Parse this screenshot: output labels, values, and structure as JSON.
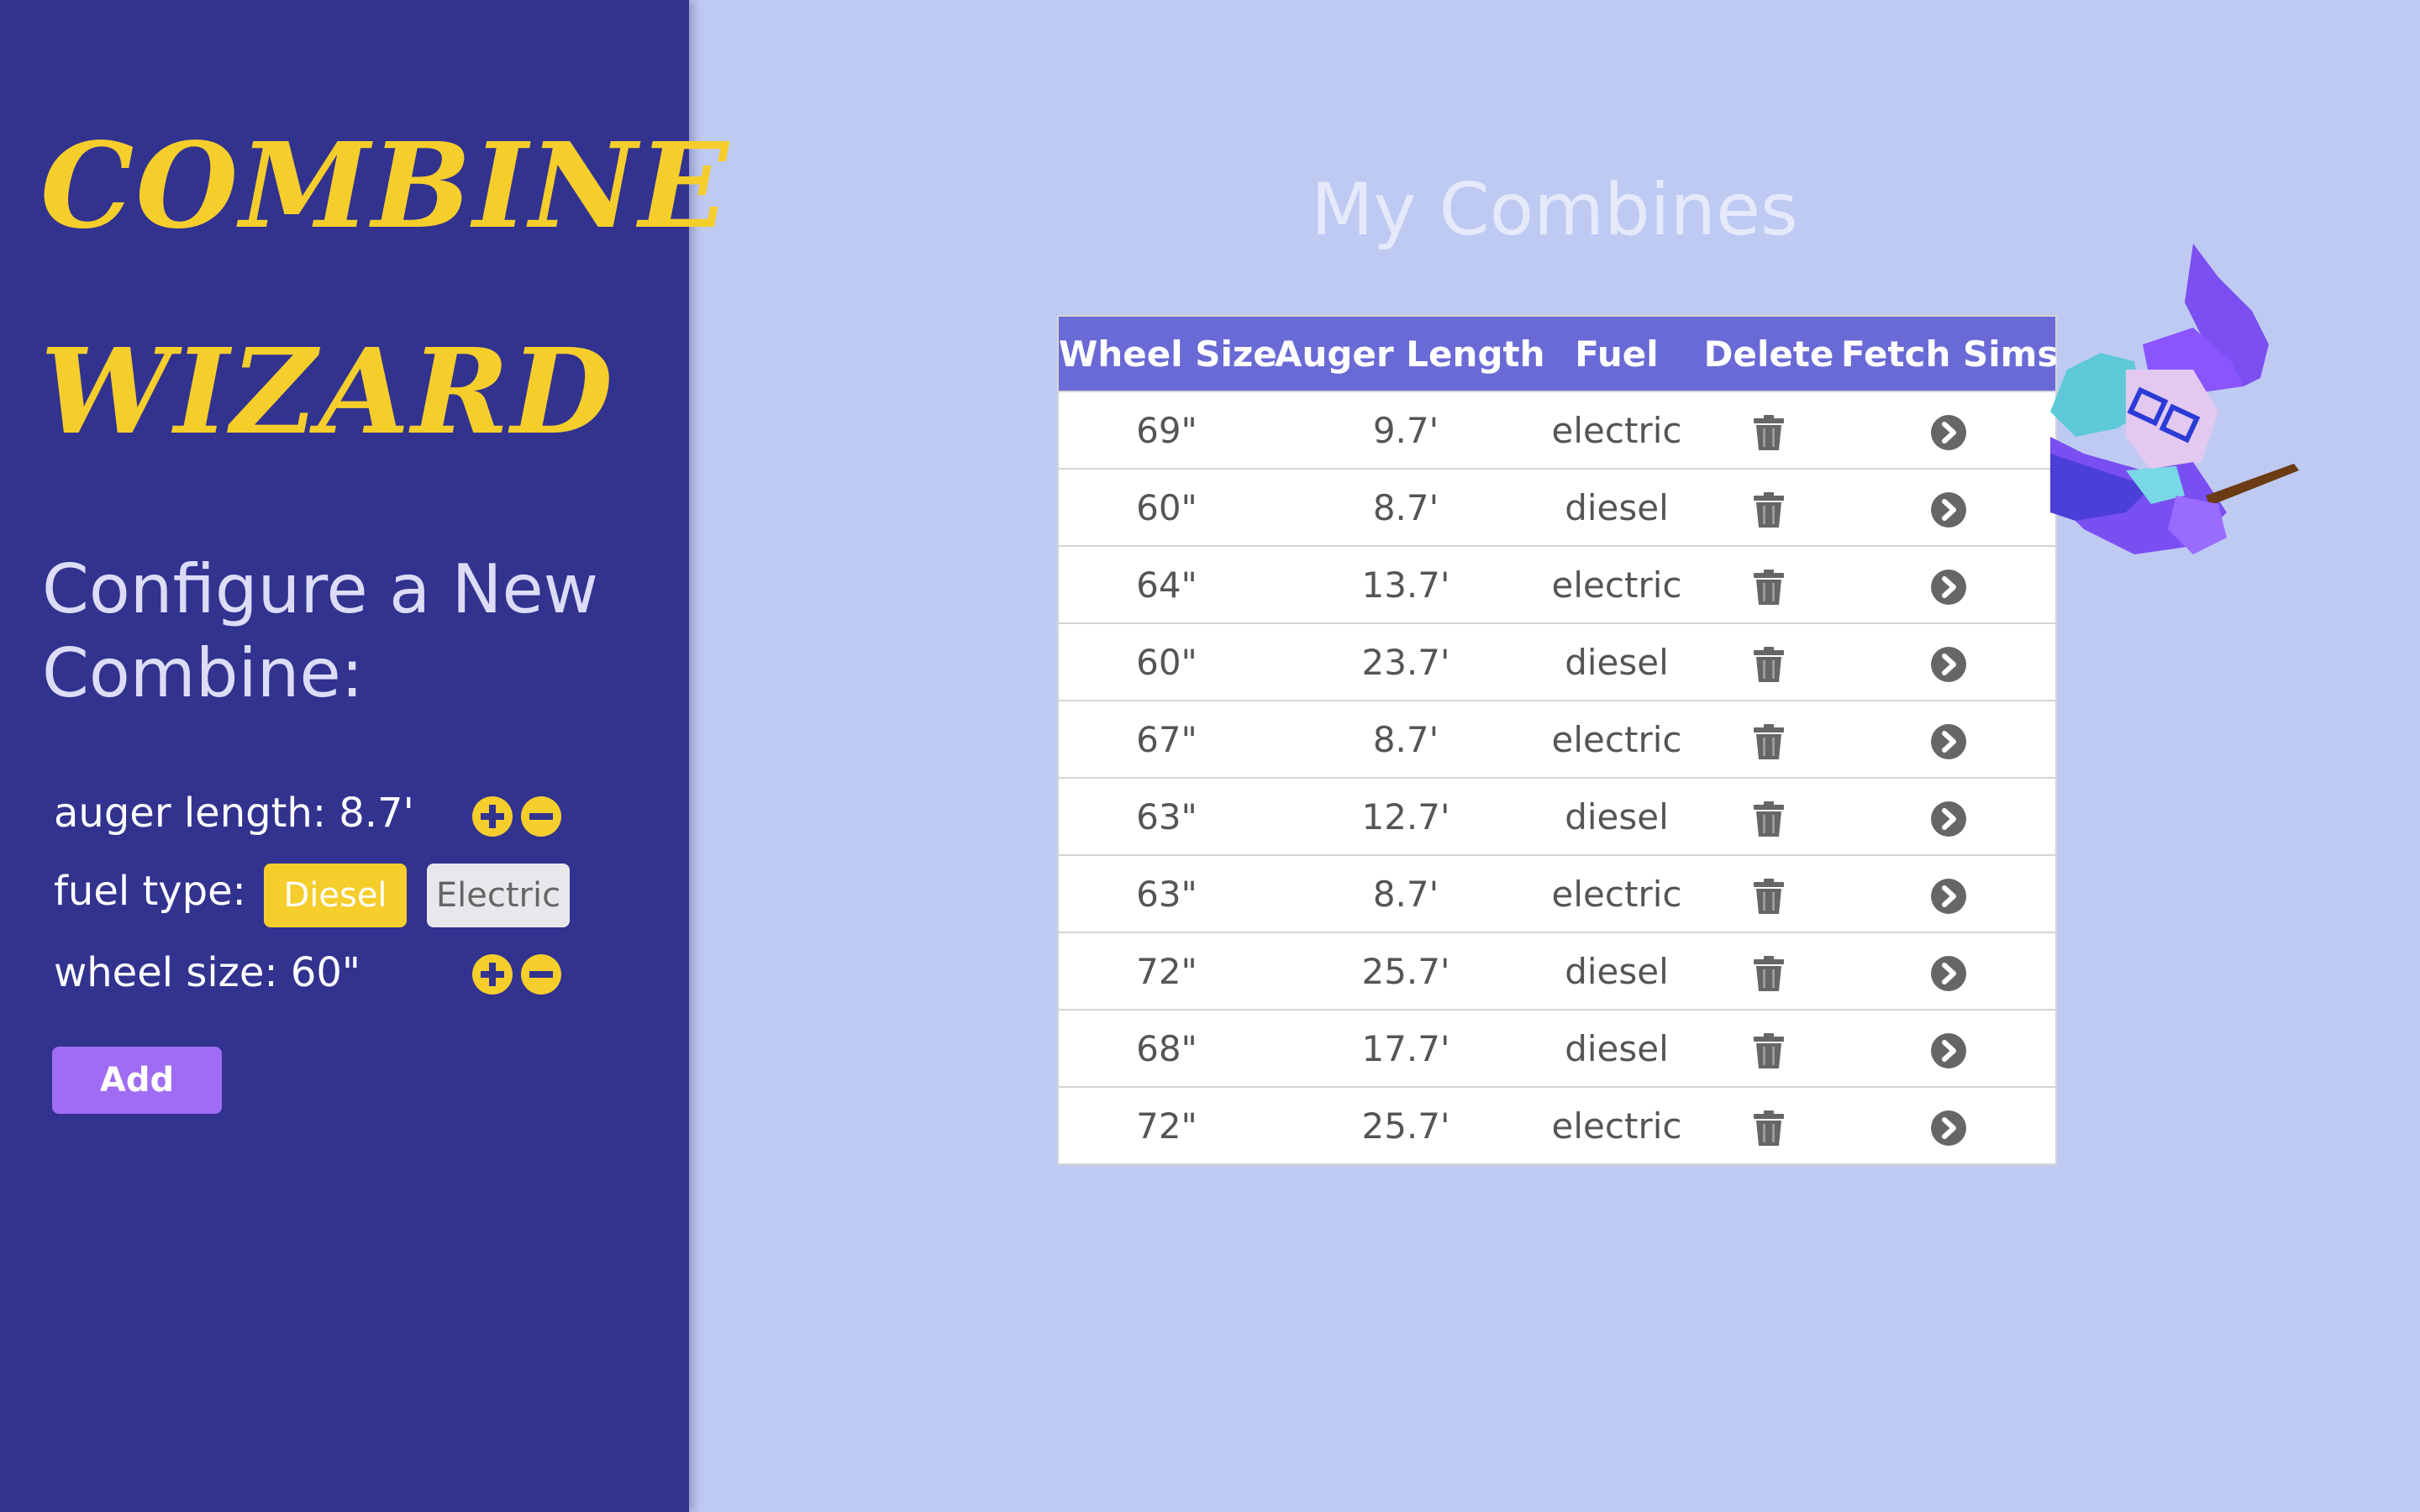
{
  "sidebar": {
    "brand_line1": "Combine",
    "brand_line2": "Wizard",
    "config_title": "Configure a New Combine:",
    "auger_label": "auger length: 8.7'",
    "fuel_label": "fuel type:",
    "fuel_options": [
      "Diesel",
      "Electric"
    ],
    "fuel_selected": "Diesel",
    "wheel_label": "wheel size: 60\"",
    "add_label": "Add"
  },
  "main": {
    "title": "My Combines",
    "columns": [
      "Wheel Size",
      "Auger Length",
      "Fuel",
      "Delete",
      "Fetch Sims"
    ],
    "rows": [
      {
        "wheel": "69\"",
        "auger": "9.7'",
        "fuel": "electric"
      },
      {
        "wheel": "60\"",
        "auger": "8.7'",
        "fuel": "diesel"
      },
      {
        "wheel": "64\"",
        "auger": "13.7'",
        "fuel": "electric"
      },
      {
        "wheel": "60\"",
        "auger": "23.7'",
        "fuel": "diesel"
      },
      {
        "wheel": "67\"",
        "auger": "8.7'",
        "fuel": "electric"
      },
      {
        "wheel": "63\"",
        "auger": "12.7'",
        "fuel": "diesel"
      },
      {
        "wheel": "63\"",
        "auger": "8.7'",
        "fuel": "electric"
      },
      {
        "wheel": "72\"",
        "auger": "25.7'",
        "fuel": "diesel"
      },
      {
        "wheel": "68\"",
        "auger": "17.7'",
        "fuel": "diesel"
      },
      {
        "wheel": "72\"",
        "auger": "25.7'",
        "fuel": "electric"
      }
    ]
  },
  "icons": {
    "delete": "trash-icon",
    "fetch": "chevron-right-circle-icon",
    "increment": "plus-circle-icon",
    "decrement": "minus-circle-icon"
  },
  "colors": {
    "sidebar_bg": "#32328f",
    "main_bg": "#bfcaf2",
    "brand": "#f5ce2c",
    "table_header": "#6a6ad6",
    "add_button": "#a06cf4"
  }
}
